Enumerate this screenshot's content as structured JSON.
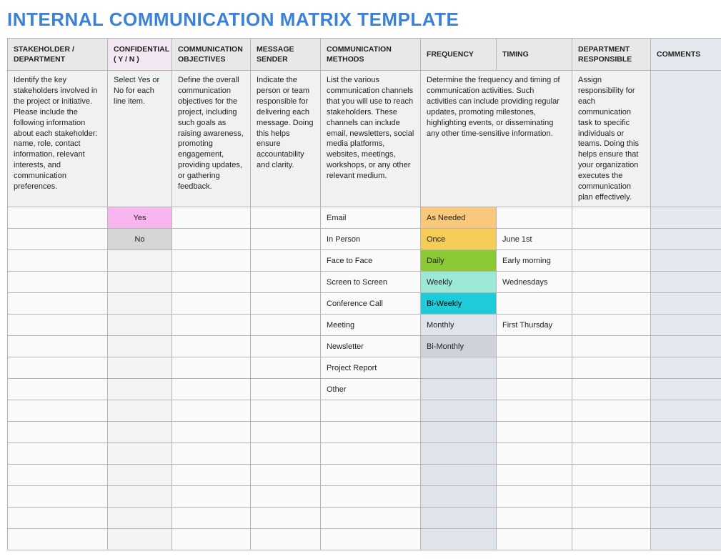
{
  "title": "INTERNAL COMMUNICATION MATRIX TEMPLATE",
  "headers": {
    "stakeholder": "STAKEHOLDER / DEPARTMENT",
    "confidential": "CONFIDENTIAL ( Y / N )",
    "objectives": "COMMUNICATION OBJECTIVES",
    "sender": "MESSAGE SENDER",
    "methods": "COMMUNICATION METHODS",
    "frequency": "FREQUENCY",
    "timing": "TIMING",
    "responsible": "DEPARTMENT RESPONSIBLE",
    "comments": "COMMENTS"
  },
  "descriptions": {
    "stakeholder": "Identify the key stakeholders involved in the project or initiative. Please include the following information about each stakeholder: name, role, contact information, relevant interests, and communication preferences.",
    "confidential": "Select Yes or No for each line item.",
    "objectives": "Define the overall communication objectives for the project, including such goals as raising awareness, promoting engagement, providing updates, or gathering feedback.",
    "sender": "Indicate the person or team responsible for delivering each message. Doing this helps ensure accountability and clarity.",
    "methods": "List the various communication channels that you will use to reach stakeholders. These channels can include email, newsletters, social media platforms, websites, meetings, workshops, or any other relevant medium.",
    "freq_timing": "Determine the frequency and timing of communication activities. Such activities can include providing regular updates, promoting milestones, highlighting events, or disseminating any other time-sensitive information.",
    "responsible": "Assign responsibility for each communication task to specific individuals or teams. Doing this helps ensure that your organization executes the communication plan effectively.",
    "comments": ""
  },
  "rows": [
    {
      "confidential": "Yes",
      "confClass": "hl-pink",
      "method": "Email",
      "frequency": "As Needed",
      "freqClass": "hl-orange",
      "timing": ""
    },
    {
      "confidential": "No",
      "confClass": "hl-gray",
      "method": "In Person",
      "frequency": "Once",
      "freqClass": "hl-yellow",
      "timing": "June 1st"
    },
    {
      "confidential": "",
      "confClass": "",
      "method": "Face to Face",
      "frequency": "Daily",
      "freqClass": "hl-green",
      "timing": "Early morning"
    },
    {
      "confidential": "",
      "confClass": "",
      "method": "Screen to Screen",
      "frequency": "Weekly",
      "freqClass": "hl-mint",
      "timing": "Wednesdays"
    },
    {
      "confidential": "",
      "confClass": "",
      "method": "Conference Call",
      "frequency": "Bi-Weekly",
      "freqClass": "hl-cyan",
      "timing": ""
    },
    {
      "confidential": "",
      "confClass": "",
      "method": "Meeting",
      "frequency": "Monthly",
      "freqClass": "",
      "timing": "First Thursday"
    },
    {
      "confidential": "",
      "confClass": "",
      "method": "Newsletter",
      "frequency": "Bi-Monthly",
      "freqClass": "hl-ltgray",
      "timing": ""
    },
    {
      "confidential": "",
      "confClass": "",
      "method": "Project Report",
      "frequency": "",
      "freqClass": "",
      "timing": ""
    },
    {
      "confidential": "",
      "confClass": "",
      "method": "Other",
      "frequency": "",
      "freqClass": "",
      "timing": ""
    },
    {
      "confidential": "",
      "confClass": "",
      "method": "",
      "frequency": "",
      "freqClass": "",
      "timing": ""
    },
    {
      "confidential": "",
      "confClass": "",
      "method": "",
      "frequency": "",
      "freqClass": "",
      "timing": ""
    },
    {
      "confidential": "",
      "confClass": "",
      "method": "",
      "frequency": "",
      "freqClass": "",
      "timing": ""
    },
    {
      "confidential": "",
      "confClass": "",
      "method": "",
      "frequency": "",
      "freqClass": "",
      "timing": ""
    },
    {
      "confidential": "",
      "confClass": "",
      "method": "",
      "frequency": "",
      "freqClass": "",
      "timing": ""
    },
    {
      "confidential": "",
      "confClass": "",
      "method": "",
      "frequency": "",
      "freqClass": "",
      "timing": ""
    },
    {
      "confidential": "",
      "confClass": "",
      "method": "",
      "frequency": "",
      "freqClass": "",
      "timing": ""
    }
  ]
}
